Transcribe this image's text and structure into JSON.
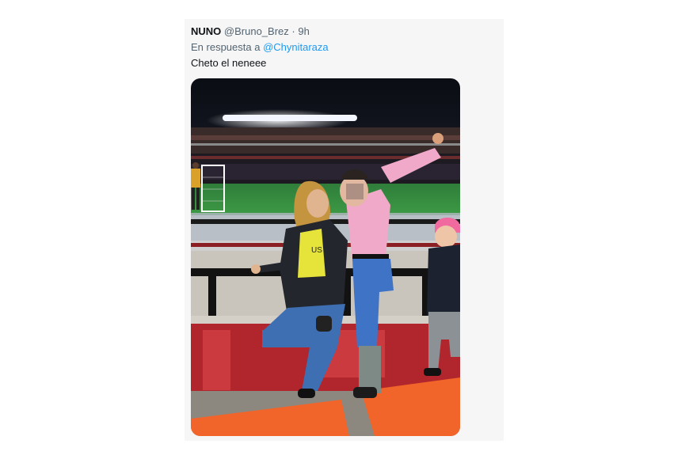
{
  "tweet": {
    "display_name": "NUNO",
    "handle": "@Bruno_Brez",
    "separator": "·",
    "time": "9h",
    "reply_prefix": "En respuesta a",
    "reply_to": "@Chynitaraza",
    "text": "Cheto el neneee"
  },
  "media": {
    "jersey_text": "US"
  },
  "colors": {
    "name": "#0f1419",
    "secondary_text": "#536471",
    "link": "#1d9bf0",
    "card_background": "#f6f6f6"
  }
}
